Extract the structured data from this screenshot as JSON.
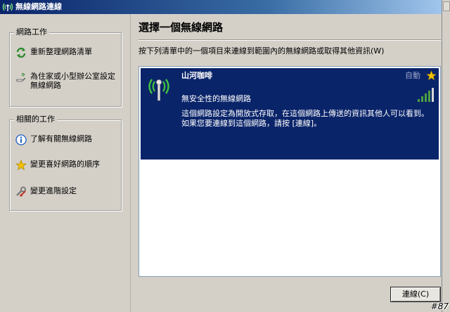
{
  "window": {
    "title": "無線網路連線"
  },
  "tasks_network": {
    "heading": "網路工作",
    "items": [
      {
        "label": "重新整理網路清單",
        "icon": "refresh-icon"
      },
      {
        "label": "為住家或小型辦公室設定無線網路",
        "icon": "wireless-setup-icon"
      }
    ]
  },
  "tasks_related": {
    "heading": "相關的工作",
    "items": [
      {
        "label": "了解有關無線網路",
        "icon": "info-icon"
      },
      {
        "label": "變更喜好網路的順序",
        "icon": "star-icon"
      },
      {
        "label": "變更進階設定",
        "icon": "settings-icon"
      }
    ]
  },
  "main": {
    "title": "選擇一個無線網路",
    "instructions": "按下列清單中的一個項目來連線到範圍內的無線網路或取得其他資訊(W)"
  },
  "network": {
    "ssid": "山河咖啡",
    "status": "自動",
    "security": "無安全性的無線網路",
    "description": "這個網路設定為開放式存取，在這個網路上傳送的資訊其他人可以看到。 如果您要連線到這個網路，請按 [連線]。",
    "signal_bars": 5,
    "signal_strength_bars": 4,
    "colors": {
      "selection": "#0a246a",
      "signal": "#4aa040",
      "star": "#f2c200"
    }
  },
  "buttons": {
    "connect": "連線(C)"
  },
  "watermark": "#87"
}
